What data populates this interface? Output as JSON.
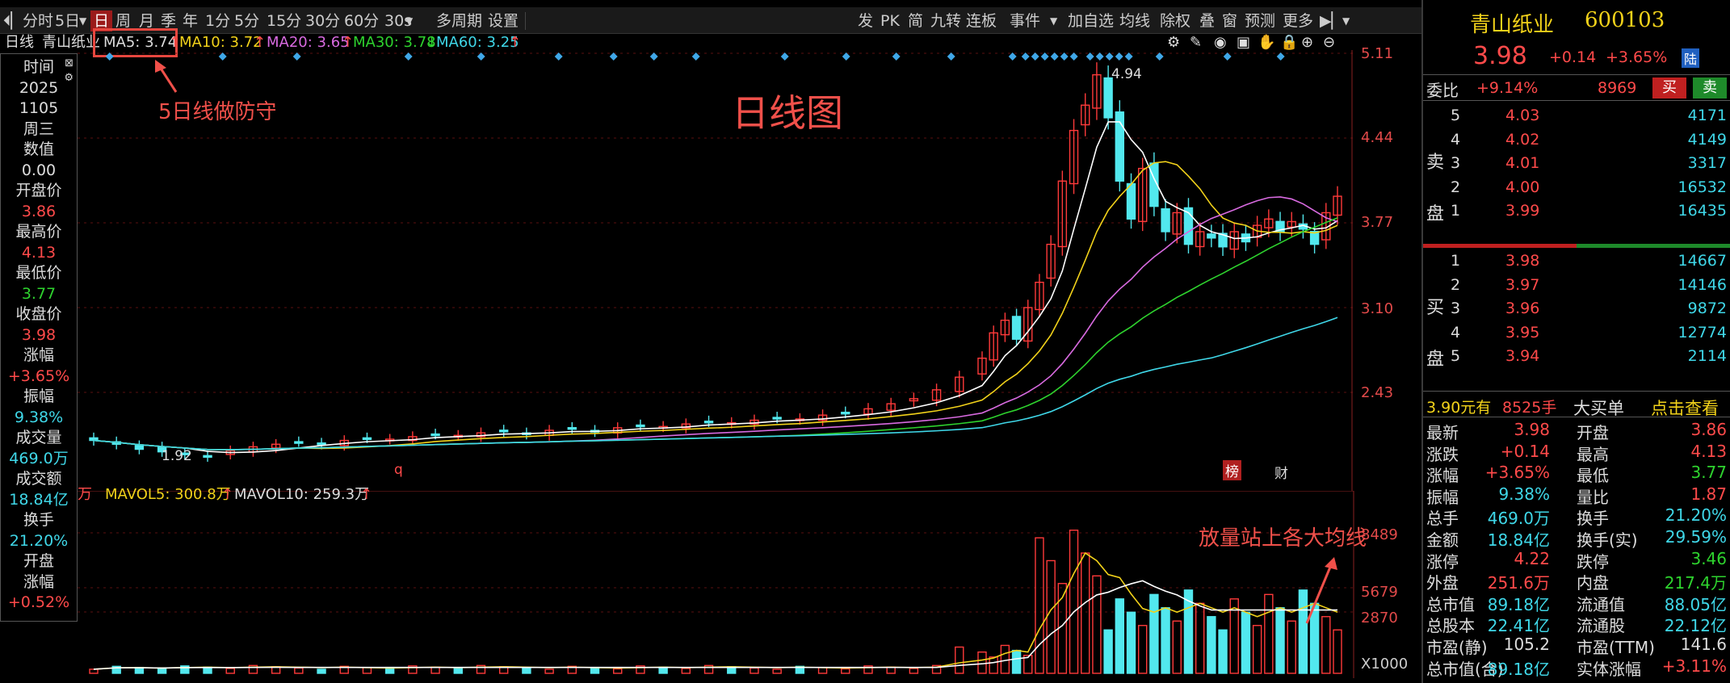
{
  "toolbar": {
    "items": [
      "分时",
      "5日",
      "日",
      "周",
      "月",
      "季",
      "年",
      "1分",
      "5分",
      "15分",
      "30分",
      "60分",
      "30s",
      "多周期",
      "设置"
    ],
    "right_items": [
      "发",
      "PK",
      "简",
      "九转",
      "连板",
      "事件",
      "加自选",
      "均线",
      "除权",
      "叠",
      "窗",
      "预测",
      "更多"
    ]
  },
  "ma": {
    "period_label": "日线",
    "stock_label": "青山纸业",
    "ma5": "MA5: 3.74",
    "ma5_arrow": "↑",
    "ma10": "MA10: 3.72",
    "ma10_arrow": "↑",
    "ma20": "MA20: 3.65",
    "ma20_arrow": "↑",
    "ma30": "MA30: 3.78",
    "ma30_arrow": "↓",
    "ma60": "MA60: 3.25",
    "ma60_arrow": "↑"
  },
  "annotations": {
    "ma5_note": "5日线做防守",
    "chart_title": "日线图",
    "vol_note": "放量站上各大均线",
    "peak": "4.94",
    "low": "1.92",
    "q_mark": "q",
    "bang": "榜",
    "cai": "财"
  },
  "price_axis": [
    "5.11",
    "4.44",
    "3.77",
    "3.10",
    "2.43"
  ],
  "vol_axis": [
    "8489",
    "5679",
    "2870",
    "X1000"
  ],
  "vol_header": {
    "unit": "万",
    "mavol5": "MAVOL5: 300.8万",
    "mavol5_arrow": "↑",
    "mavol10": "MAVOL10: 259.3万",
    "mavol10_arrow": "↑"
  },
  "side": [
    {
      "t": "时间",
      "c": "w"
    },
    {
      "t": "2025",
      "c": "w"
    },
    {
      "t": "1105",
      "c": "w"
    },
    {
      "t": "周三",
      "c": "w"
    },
    {
      "t": "数值",
      "c": "w"
    },
    {
      "t": "0.00",
      "c": "w"
    },
    {
      "t": "开盘价",
      "c": "w"
    },
    {
      "t": "3.86",
      "c": "r"
    },
    {
      "t": "最高价",
      "c": "w"
    },
    {
      "t": "4.13",
      "c": "r"
    },
    {
      "t": "最低价",
      "c": "w"
    },
    {
      "t": "3.77",
      "c": "g"
    },
    {
      "t": "收盘价",
      "c": "w"
    },
    {
      "t": "3.98",
      "c": "r"
    },
    {
      "t": "涨幅",
      "c": "w"
    },
    {
      "t": "+3.65%",
      "c": "r"
    },
    {
      "t": "振幅",
      "c": "w"
    },
    {
      "t": "9.38%",
      "c": "c"
    },
    {
      "t": "成交量",
      "c": "w"
    },
    {
      "t": "469.0万",
      "c": "c"
    },
    {
      "t": "成交额",
      "c": "w"
    },
    {
      "t": "18.84亿",
      "c": "c"
    },
    {
      "t": "换手",
      "c": "w"
    },
    {
      "t": "21.20%",
      "c": "c"
    },
    {
      "t": "开盘",
      "c": "w"
    },
    {
      "t": "涨幅",
      "c": "w"
    },
    {
      "t": "+0.52%",
      "c": "r"
    }
  ],
  "quote": {
    "name": "青山纸业",
    "code": "600103",
    "price": "3.98",
    "change": "+0.14",
    "pct": "+3.65%",
    "tag": "陆",
    "weibi_label": "委比",
    "weibi": "+9.14%",
    "weicha": "8969",
    "buy_btn": "买",
    "sell_btn": "卖",
    "sell_label": "卖盘",
    "buy_label": "买盘",
    "asks": [
      {
        "n": "5",
        "p": "4.03",
        "v": "4171"
      },
      {
        "n": "4",
        "p": "4.02",
        "v": "4149"
      },
      {
        "n": "3",
        "p": "4.01",
        "v": "3317"
      },
      {
        "n": "2",
        "p": "4.00",
        "v": "16532"
      },
      {
        "n": "1",
        "p": "3.99",
        "v": "16435"
      }
    ],
    "bids": [
      {
        "n": "1",
        "p": "3.98",
        "v": "14667"
      },
      {
        "n": "2",
        "p": "3.97",
        "v": "14146"
      },
      {
        "n": "3",
        "p": "3.96",
        "v": "9872"
      },
      {
        "n": "4",
        "p": "3.95",
        "v": "12774"
      },
      {
        "n": "5",
        "p": "3.94",
        "v": "2114"
      }
    ],
    "bigorder": {
      "price": "3.90元有",
      "vol": "8525手",
      "label": "大买单",
      "link": "点击查看"
    },
    "stats": [
      [
        "最新",
        "3.98",
        "r",
        "开盘",
        "3.86",
        "r"
      ],
      [
        "涨跌",
        "+0.14",
        "r",
        "最高",
        "4.13",
        "r"
      ],
      [
        "涨幅",
        "+3.65%",
        "r",
        "最低",
        "3.77",
        "g"
      ],
      [
        "振幅",
        "9.38%",
        "c",
        "量比",
        "1.87",
        "r"
      ],
      [
        "总手",
        "469.0万",
        "c",
        "换手",
        "21.20%",
        "c"
      ],
      [
        "金额",
        "18.84亿",
        "c",
        "换手(实)",
        "29.59%",
        "c"
      ],
      [
        "涨停",
        "4.22",
        "r",
        "跌停",
        "3.46",
        "g"
      ],
      [
        "外盘",
        "251.6万",
        "r",
        "内盘",
        "217.4万",
        "g"
      ],
      [
        "总市值",
        "89.18亿",
        "c",
        "流通值",
        "88.05亿",
        "c"
      ],
      [
        "总股本",
        "22.41亿",
        "c",
        "流通股",
        "22.12亿",
        "c"
      ],
      [
        "市盈(静)",
        "105.2",
        "w",
        "市盈(TTM)",
        "141.6",
        "w"
      ],
      [
        "总市值(合)",
        "89.18亿",
        "c",
        "实体涨幅",
        "+3.11%",
        "r"
      ]
    ]
  },
  "chart_data": {
    "type": "candlestick",
    "ticker": "600103",
    "period": "daily",
    "y_ticks": [
      5.11,
      4.44,
      3.77,
      3.1,
      2.43
    ],
    "high_label": 4.94,
    "low_label": 1.92,
    "ma": {
      "MA5": 3.74,
      "MA10": 3.72,
      "MA20": 3.65,
      "MA30": 3.78,
      "MA60": 3.25
    },
    "closes": [
      2.05,
      2.02,
      1.98,
      1.96,
      1.94,
      1.92,
      1.97,
      2.0,
      2.02,
      2.04,
      2.02,
      2.05,
      2.07,
      2.06,
      2.08,
      2.1,
      2.09,
      2.11,
      2.12,
      2.1,
      2.13,
      2.14,
      2.12,
      2.15,
      2.17,
      2.16,
      2.18,
      2.2,
      2.19,
      2.21,
      2.23,
      2.22,
      2.25,
      2.27,
      2.3,
      2.34,
      2.38,
      2.45,
      2.55,
      2.7,
      2.9,
      3.0,
      2.85,
      3.1,
      3.3,
      3.6,
      4.1,
      4.5,
      4.7,
      4.94,
      4.6,
      4.1,
      3.8,
      4.2,
      3.9,
      3.7,
      3.85,
      3.6,
      3.7,
      3.65,
      3.58,
      3.7,
      3.62,
      3.75,
      3.8,
      3.7,
      3.78,
      3.72,
      3.6,
      3.85,
      3.98
    ],
    "volume_series": [
      {
        "name": "MAVOL5",
        "last": 300.8
      },
      {
        "name": "MAVOL10",
        "last": 259.3
      }
    ]
  }
}
